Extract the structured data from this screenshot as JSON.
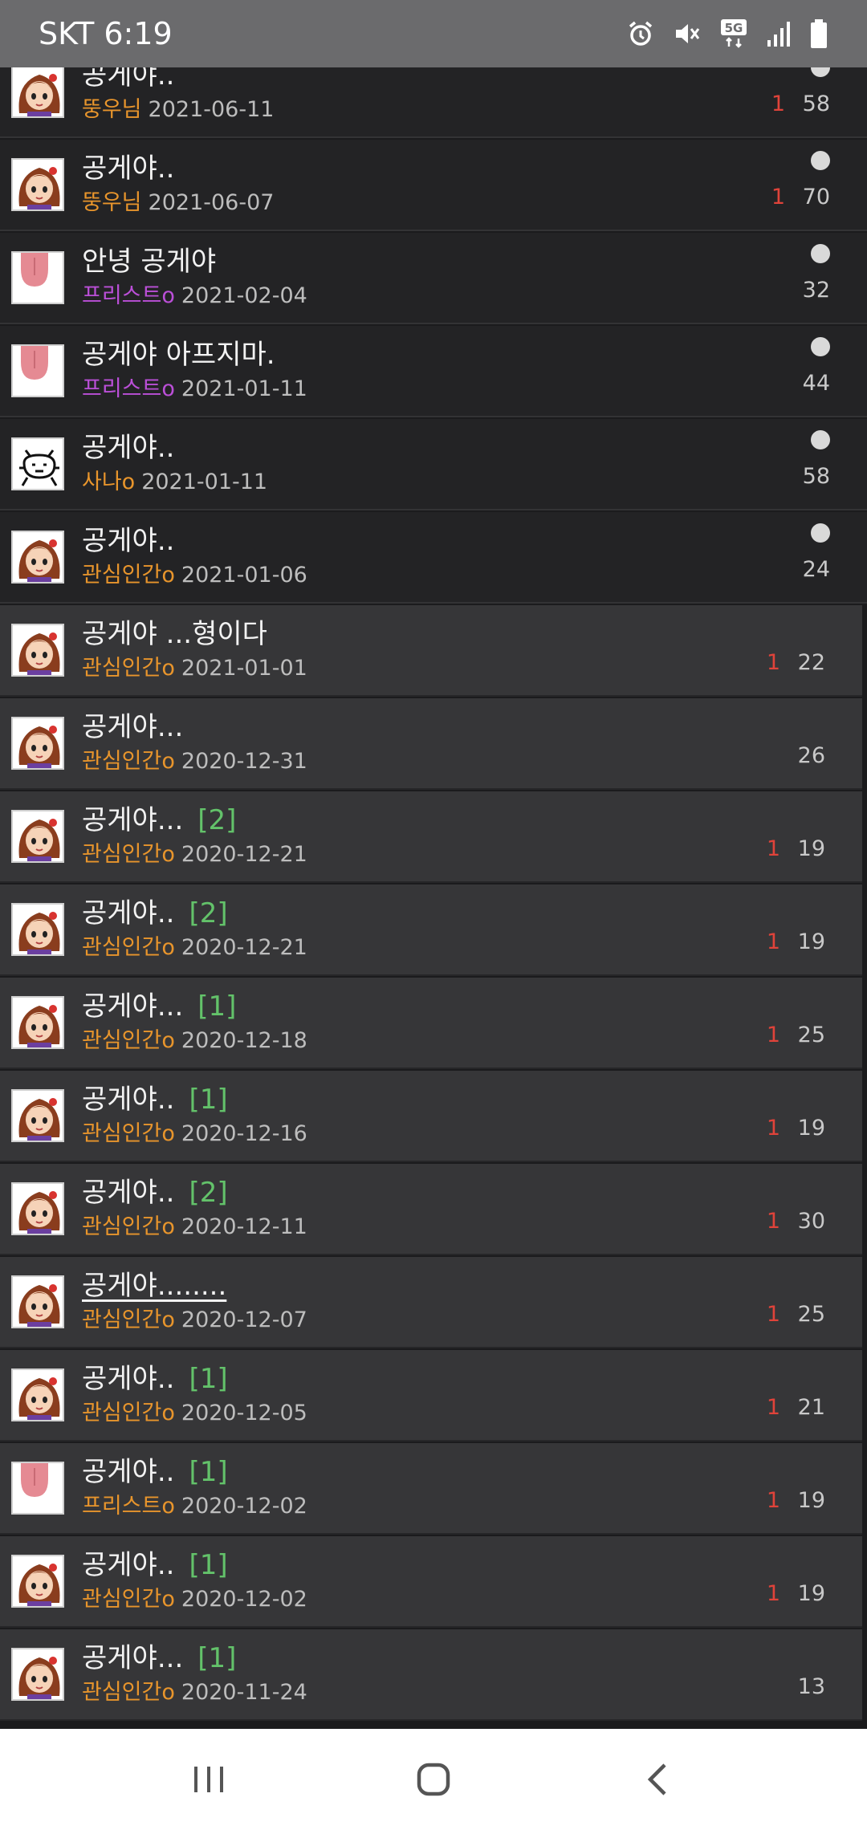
{
  "status_bar": {
    "left_text": "SKT 6:19",
    "icons": [
      "alarm-icon",
      "mute-icon",
      "5g-icon",
      "signal-icon",
      "battery-icon"
    ],
    "network_label": "5G"
  },
  "rows": [
    {
      "title": "공게야..",
      "badge": "",
      "author": "뚱우님",
      "author_color": "orange",
      "date": "2021-06-11",
      "new": "1",
      "views": "58",
      "dot": true,
      "theme": "dark",
      "avatar": "girl"
    },
    {
      "title": "공게야..",
      "badge": "",
      "author": "뚱우님",
      "author_color": "orange",
      "date": "2021-06-07",
      "new": "1",
      "views": "70",
      "dot": true,
      "theme": "dark",
      "avatar": "girl"
    },
    {
      "title": "안녕 공게야",
      "badge": "",
      "author": "프리스트o",
      "author_color": "purple",
      "date": "2021-02-04",
      "new": "",
      "views": "32",
      "dot": true,
      "theme": "dark",
      "avatar": "tongue"
    },
    {
      "title": "공게야 아프지마.",
      "badge": "",
      "author": "프리스트o",
      "author_color": "purple",
      "date": "2021-01-11",
      "new": "",
      "views": "44",
      "dot": true,
      "theme": "dark",
      "avatar": "tongue"
    },
    {
      "title": "공게야..",
      "badge": "",
      "author": "사나o",
      "author_color": "orange",
      "date": "2021-01-11",
      "new": "",
      "views": "58",
      "dot": true,
      "theme": "dark",
      "avatar": "doodle"
    },
    {
      "title": "공게야..",
      "badge": "",
      "author": "관심인간o",
      "author_color": "orange",
      "date": "2021-01-06",
      "new": "",
      "views": "24",
      "dot": true,
      "theme": "dark",
      "avatar": "girl"
    },
    {
      "title": "공게야 ...형이다",
      "badge": "",
      "author": "관심인간o",
      "author_color": "orange",
      "date": "2021-01-01",
      "new": "1",
      "views": "22",
      "dot": false,
      "theme": "light",
      "avatar": "girl"
    },
    {
      "title": "공게야...",
      "badge": "",
      "author": "관심인간o",
      "author_color": "orange",
      "date": "2020-12-31",
      "new": "",
      "views": "26",
      "dot": false,
      "theme": "light",
      "avatar": "girl"
    },
    {
      "title": "공게야...",
      "badge": "[2]",
      "author": "관심인간o",
      "author_color": "orange",
      "date": "2020-12-21",
      "new": "1",
      "views": "19",
      "dot": false,
      "theme": "light",
      "avatar": "girl"
    },
    {
      "title": "공게야..",
      "badge": "[2]",
      "author": "관심인간o",
      "author_color": "orange",
      "date": "2020-12-21",
      "new": "1",
      "views": "19",
      "dot": false,
      "theme": "light",
      "avatar": "girl"
    },
    {
      "title": "공게야...",
      "badge": "[1]",
      "author": "관심인간o",
      "author_color": "orange",
      "date": "2020-12-18",
      "new": "1",
      "views": "25",
      "dot": false,
      "theme": "light",
      "avatar": "girl"
    },
    {
      "title": "공게야..",
      "badge": "[1]",
      "author": "관심인간o",
      "author_color": "orange",
      "date": "2020-12-16",
      "new": "1",
      "views": "19",
      "dot": false,
      "theme": "light",
      "avatar": "girl"
    },
    {
      "title": "공게야..",
      "badge": "[2]",
      "author": "관심인간o",
      "author_color": "orange",
      "date": "2020-12-11",
      "new": "1",
      "views": "30",
      "dot": false,
      "theme": "light",
      "avatar": "girl"
    },
    {
      "title": "공게야........",
      "badge": "",
      "author": "관심인간o",
      "author_color": "orange",
      "date": "2020-12-07",
      "new": "1",
      "views": "25",
      "dot": false,
      "theme": "light",
      "avatar": "girl",
      "underline": true
    },
    {
      "title": "공게야..",
      "badge": "[1]",
      "author": "관심인간o",
      "author_color": "orange",
      "date": "2020-12-05",
      "new": "1",
      "views": "21",
      "dot": false,
      "theme": "light",
      "avatar": "girl"
    },
    {
      "title": "공게야..",
      "badge": "[1]",
      "author": "프리스트o",
      "author_color": "orange",
      "date": "2020-12-02",
      "new": "1",
      "views": "19",
      "dot": false,
      "theme": "light",
      "avatar": "tongue"
    },
    {
      "title": "공게야..",
      "badge": "[1]",
      "author": "관심인간o",
      "author_color": "orange",
      "date": "2020-12-02",
      "new": "1",
      "views": "19",
      "dot": false,
      "theme": "light",
      "avatar": "girl"
    },
    {
      "title": "공게야...",
      "badge": "[1]",
      "author": "관심인간o",
      "author_color": "orange",
      "date": "2020-11-24",
      "new": "",
      "views": "13",
      "dot": false,
      "theme": "light",
      "avatar": "girl"
    }
  ],
  "nav_bar": {
    "icons": [
      "recent-apps-icon",
      "home-icon",
      "back-icon"
    ]
  }
}
